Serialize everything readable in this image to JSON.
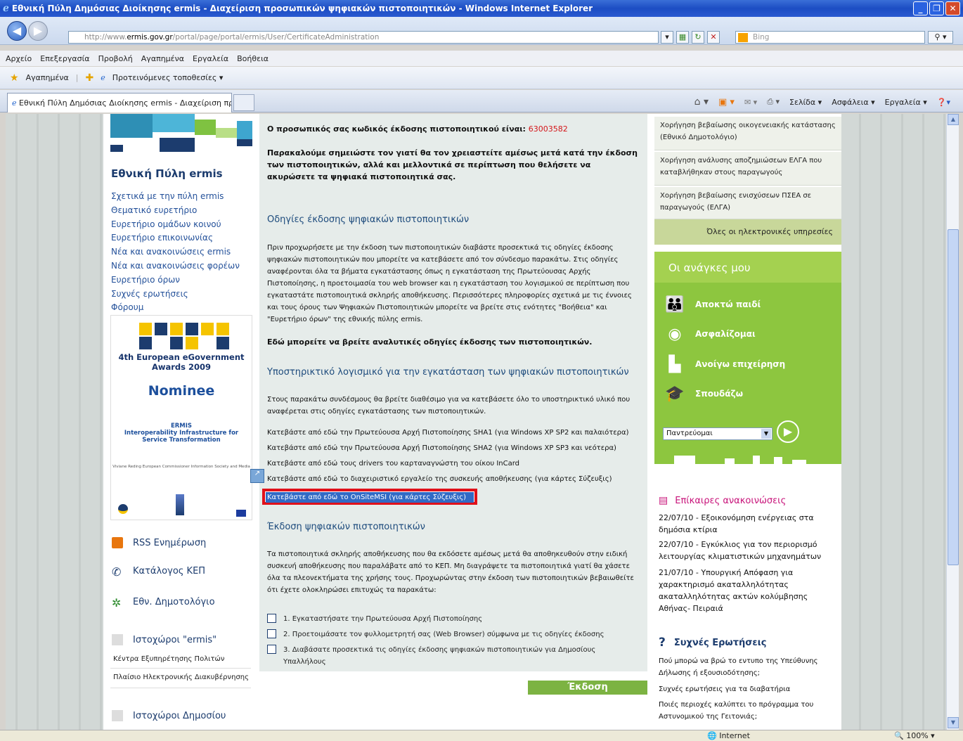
{
  "window": {
    "title": "Εθνική Πύλη Δημόσιας Διοίκησης ermis - Διαχείριση προσωπικών ψηφιακών πιστοποιητικών - Windows Internet Explorer",
    "min": "_",
    "max": "❐",
    "close": "✕"
  },
  "address": {
    "url_prefix": "http://www.",
    "url_domain": "ermis.gov.gr",
    "url_path": "/portal/page/portal/ermis/User/CertificateAdministration",
    "search_placeholder": "Bing"
  },
  "menu": [
    "Αρχείο",
    "Επεξεργασία",
    "Προβολή",
    "Αγαπημένα",
    "Εργαλεία",
    "Βοήθεια"
  ],
  "favorites": {
    "label": "Αγαπημένα",
    "suggested": "Προτεινόμενες τοποθεσίες ▾"
  },
  "tab": {
    "label": "Εθνική Πύλη Δημόσιας Διοίκησης ermis - Διαχείριση πρ..."
  },
  "commandbar": [
    "Σελίδα ▾",
    "Ασφάλεια ▾",
    "Εργαλεία ▾"
  ],
  "left": {
    "portal_title": "Εθνική Πύλη ermis",
    "nav": [
      "Σχετικά με την πύλη ermis",
      "Θεματικό ευρετήριο",
      "Ευρετήριο ομάδων κοινού",
      "Ευρετήριο επικοινωνίας",
      "Νέα και ανακοινώσεις ermis",
      "Νέα και ανακοινώσεις φορέων",
      "Ευρετήριο όρων",
      "Συχνές ερωτήσεις",
      "Φόρουμ"
    ],
    "award": {
      "line1": "4th European eGovernment",
      "line2": "Awards 2009",
      "nominee": "Nominee",
      "ermis": "ERMIS",
      "infra": "Interoperability Infrastructure for Service Transformation",
      "signature": "Viviane Reding European Commissioner Information Society and Media"
    },
    "rss": "RSS Ενημέρωση",
    "kep": "Κατάλογος ΚΕΠ",
    "dimotologio": "Εθν. Δημοτολόγιο",
    "ermis_sites": "Ιστοχώροι \"ermis\"",
    "sub1": "Κέντρα Εξυπηρέτησης Πολιτών",
    "sub2": "Πλαίσιο Ηλεκτρονικής Διακυβέρνησης",
    "public_sites": "Ιστοχώροι Δημοσίου"
  },
  "main": {
    "code_label": "Ο προσωπικός σας κωδικός έκδοσης πιστοποιητικού είναι: ",
    "code_value": "63003582",
    "keep_note": "Παρακαλούμε σημειώστε τον γιατί θα τον χρειαστείτε αμέσως μετά κατά την έκδοση των πιστοποιητικών, αλλά και μελλοντικά σε περίπτωση που θελήσετε να ακυρώσετε τα ψηφιακά πιστοποιητικά σας.",
    "h_instructions": "Οδηγίες έκδοσης ψηφιακών πιστοποιητικών",
    "instructions_text": "Πριν προχωρήσετε με την έκδοση των πιστοποιητικών διαβάστε προσεκτικά τις οδηγίες έκδοσης ψηφιακών πιστοποιητικών που μπορείτε να κατεβάσετε από τον σύνδεσμο παρακάτω. Στις οδηγίες αναφέρονται όλα τα βήματα εγκατάστασης όπως η εγκατάσταση της Πρωτεύουσας Αρχής Πιστοποίησης, η προετοιμασία του web browser και η εγκατάσταση του λογισμικού σε περίπτωση που εγκαταστάτε πιστοποιητικά σκληρής αποθήκευσης. Περισσότερες πληροφορίες σχετικά με τις έννοιες και τους όρους των Ψηφιακών Πιστοποιητικών μπορείτε να βρείτε στις ενότητες \"Βοήθεια\" και \"Ευρετήριο όρων\" της εθνικής πύλης ermis.",
    "detailed_link": "Εδώ μπορείτε να βρείτε αναλυτικές οδηγίες έκδοσης των πιστοποιητικών.",
    "h_software": "Υποστηρικτικό λογισμικό για την εγκατάσταση των ψηφιακών πιστοποιητικών",
    "software_text": "Στους παρακάτω συνδέσμους θα βρείτε διαθέσιμο για να κατεβάσετε όλο το υποστηρικτικό υλικό που αναφέρεται στις οδηγίες εγκατάστασης των πιστοποιητικών.",
    "dl1": "Κατεβάστε από εδώ την Πρωτεύουσα Αρχή Πιστοποίησης SHA1 (για Windows XP SP2 και παλαιότερα)",
    "dl2": "Κατεβάστε από εδώ την Πρωτεύουσα Αρχή Πιστοποίησης SHA2 (για Windows XP SP3 και νεότερα)",
    "dl3": "Κατεβάστε από εδώ τους drivers του καρταναγνώστη του οίκου InCard",
    "dl4": "Κατεβάστε από εδώ το διαχειριστικό εργαλείο της συσκευής αποθήκευσης (για κάρτες Σύζευξις)",
    "dl5": "Κατεβάστε από εδώ το OnSiteMSI (για κάρτες Σύζευξις)",
    "h_issue": "Έκδοση ψηφιακών πιστοποιητικών",
    "issue_text": "Τα πιστοποιητικά σκληρής αποθήκευσης που θα εκδόσετε αμέσως μετά θα αποθηκευθούν στην ειδική συσκευή αποθήκευσης που παραλάβατε από το ΚΕΠ. Μη διαγράψετε τα πιστοποιητικά γιατί θα χάσετε όλα τα πλεονεκτήματα της χρήσης τους. Προχωρώντας στην έκδοση των πιστοποιητικών βεβαιωθείτε ότι έχετε ολοκληρώσει επιτυχώς τα παρακάτω:",
    "chk1": "1. Εγκαταστήσατε την Πρωτεύουσα Αρχή Πιστοποίησης",
    "chk2": "2. Προετοιμάσατε τον φυλλομετρητή σας (Web Browser) σύμφωνα με τις οδηγίες έκδοσης",
    "chk3": "3. Διαβάσατε προσεκτικά τις οδηγίες έκδοσης ψηφιακών πιστοποιητικών για Δημοσίους Υπαλλήλους",
    "issue_button": "Έκδοση Πιστοποιητικών"
  },
  "right": {
    "svc1": "Χορήγηση βεβαίωσης οικογενειακής κατάστασης (Εθνικό Δημοτολόγιο)",
    "svc2": "Χορήγηση ανάλυσης αποζημιώσεων ΕΛΓΑ που καταβλήθηκαν στους παραγωγούς",
    "svc3": "Χορήγηση βεβαίωσης ενισχύσεων ΠΣΕΑ σε παραγωγούς (ΕΛΓΑ)",
    "all_services": "Όλες οι ηλεκτρονικές υπηρεσίες",
    "needs_title": "Οι ανάγκες μου",
    "needs": [
      "Αποκτώ παιδί",
      "Ασφαλίζομαι",
      "Ανοίγω επιχείρηση",
      "Σπουδάζω"
    ],
    "needs_select": "Παντρεύομαι",
    "news_title": "Επίκαιρες ανακοινώσεις",
    "news": [
      "22/07/10 - Εξοικονόμηση ενέργειας στα δημόσια κτίρια",
      "22/07/10 - Εγκύκλιος για τον περιορισμό λειτουργίας κλιματιστικών μηχανημάτων",
      "21/07/10 - Υπουργική Απόφαση για χαρακτηρισμό ακαταλληλότητας ακαταλληλότητας ακτών κολύμβησης Αθήνας- Πειραιά"
    ],
    "faq_title": "Συχνές Ερωτήσεις",
    "faq": [
      "Πού μπορώ να βρώ το εντυπο της Υπεύθυνης Δήλωσης ή εξουσιοδότησης;",
      "Συχνές ερωτήσεις για τα διαβατήρια",
      "Ποιές περιοχές καλύπτει το πρόγραμμα του Αστυνομικού της Γειτονιάς;"
    ]
  },
  "status": {
    "zone": "Internet",
    "zoom": "100%"
  },
  "colors": {
    "accent_green": "#8dc63f",
    "code_red": "#d4161a",
    "highlight_red": "#e0101a",
    "link_blue": "#24519a"
  }
}
